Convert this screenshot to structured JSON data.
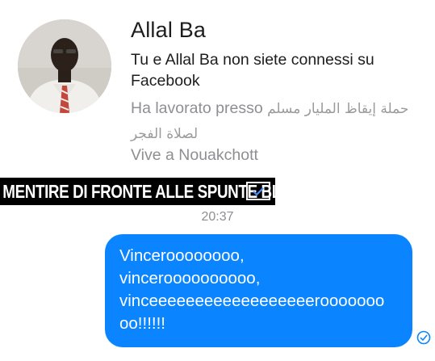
{
  "profile": {
    "name": "Allal Ba",
    "not_connected": "Tu e Allal Ba non siete connessi su Facebook",
    "work_label": "Ha lavorato presso",
    "work_org": "حملة إيقاظ المليار مسلم لصلاة الفجر",
    "location": "Vive a Nouakchott"
  },
  "banner": {
    "text": "Mentire di fronte alle Spunte Blu",
    "icon": "check-icon"
  },
  "chat": {
    "timestamp": "20:37",
    "message": "Vinceroooooooo,\nvinceroooooooooo,\nvinceeeeeeeeeeeeeeeeeerooooooo\noo!!!!!!",
    "receipt_icon": "read-check-icon"
  },
  "colors": {
    "bubble": "#0a84ff",
    "meta_text": "#8e8e93",
    "banner_bg": "#000000"
  }
}
